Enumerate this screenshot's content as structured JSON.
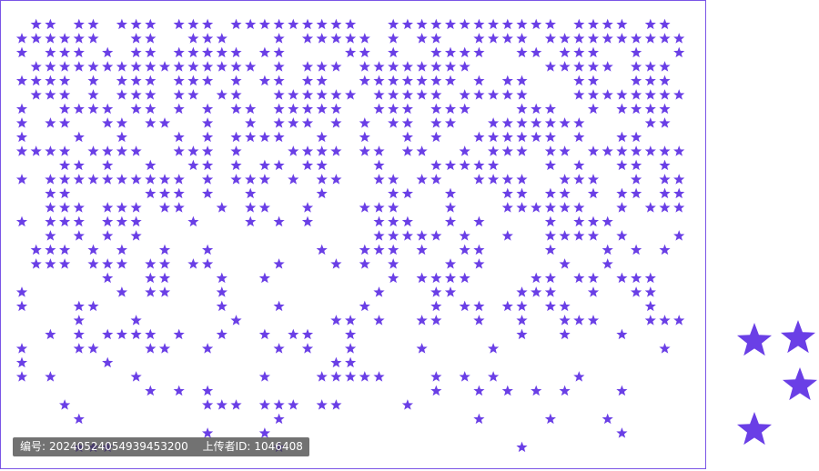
{
  "colors": {
    "star": "#6a3fe6",
    "frame": "#7a55e6",
    "background": "#ffffff"
  },
  "watermark": {
    "id_label": "编号:",
    "id_value": "20240524054939453200",
    "uploader_label": "上传者ID:",
    "uploader_value": "1046408"
  },
  "icons": {
    "pattern": "star-icon"
  }
}
